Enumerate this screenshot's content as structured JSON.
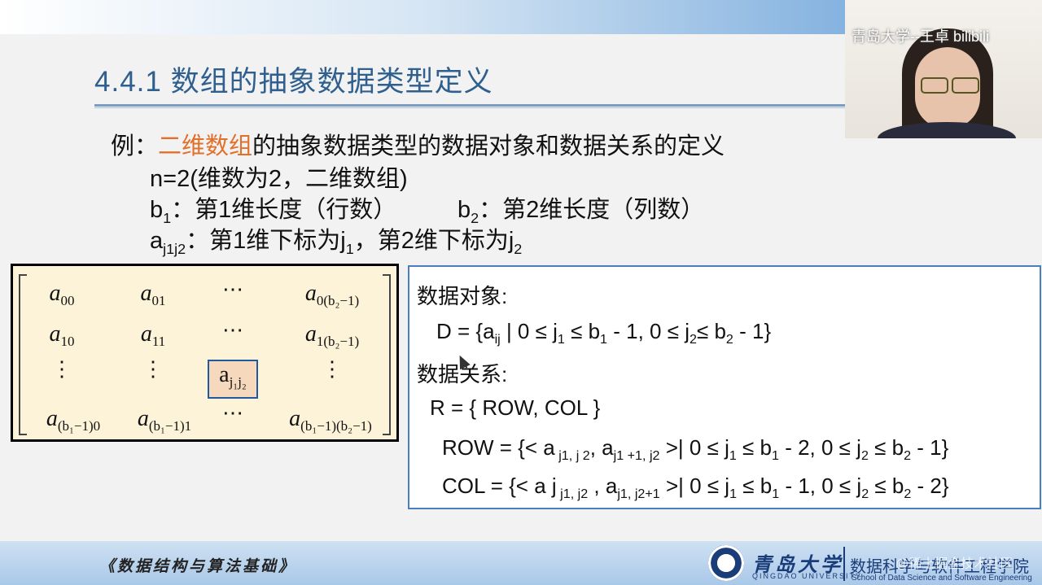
{
  "slide": {
    "title": "4.4.1 数组的抽象数据类型定义",
    "example": {
      "prefix": "例：",
      "highlight": "二维数组",
      "rest": "的抽象数据类型的数据对象和数据关系的定义"
    },
    "n_line": "n=2(维数为2，二维数组)",
    "b1": {
      "sym": "b",
      "sub": "1",
      "text": "：第1维长度（行数）"
    },
    "b2": {
      "sym": "b",
      "sub": "2",
      "text": "：第2维长度（列数）"
    },
    "a_line": {
      "sym": "a",
      "sub": "j1j2",
      "text1": "：第1维下标为j",
      "sub1": "1",
      "text2": "，第2维下标为j",
      "sub2": "2"
    }
  },
  "matrix": {
    "sym": "a",
    "rows": [
      [
        "00",
        "01",
        "⋯",
        "0(b₂−1)"
      ],
      [
        "10",
        "11",
        "⋯",
        "1(b₂−1)"
      ],
      [
        "⋮",
        "⋮",
        "j₁j₂",
        "⋮"
      ],
      [
        "(b₁−1)0",
        "(b₁−1)1",
        "⋯",
        "(b₁−1)(b₂−1)"
      ]
    ]
  },
  "relations": {
    "objects_label": "数据对象:",
    "D": "D = {a",
    "D_sub": "ij",
    "D_rest1": " | 0 ≤ j",
    "D_rest2": " ≤ b",
    "D_rest3": " - 1,  0 ≤ j",
    "D_rest4": "≤ b",
    "D_rest5": " - 1}",
    "relations_label": "数据关系:",
    "R": "R = { ROW, COL }",
    "ROW": "ROW = {< a",
    "ROW_s1": " j1, j 2",
    "ROW_m": ", a",
    "ROW_s2": "j1 +1, j2",
    "ROW_rest1": " >| 0 ≤ j",
    "ROW_rest2": " ≤ b",
    "ROW_rest3": " - 2,  0 ≤ j",
    "ROW_rest4": " ≤ b",
    "ROW_rest5": " - 1}",
    "COL": "COL  = {< a j",
    "COL_s1": " j1, j2",
    "COL_m": " , a",
    "COL_s2": "j1, j2+1",
    "COL_rest1": " >| 0 ≤ j",
    "COL_rest2": " ≤ b",
    "COL_rest3": " - 1,  0 ≤ j",
    "COL_rest4": " ≤ b",
    "COL_rest5": " - 2}",
    "one": "1",
    "two": "2"
  },
  "footer": {
    "course": "《数据结构与算法基础》",
    "university": "青岛大学",
    "university_en": "QINGDAO UNIVERSITY",
    "school": "数据科学与软件工程学院",
    "school_en": "School of Data Science and Software Engineering"
  },
  "watermark": {
    "top": "青岛大学--王卓 bilibili",
    "bottom": "@稀土掘金技术社区"
  }
}
